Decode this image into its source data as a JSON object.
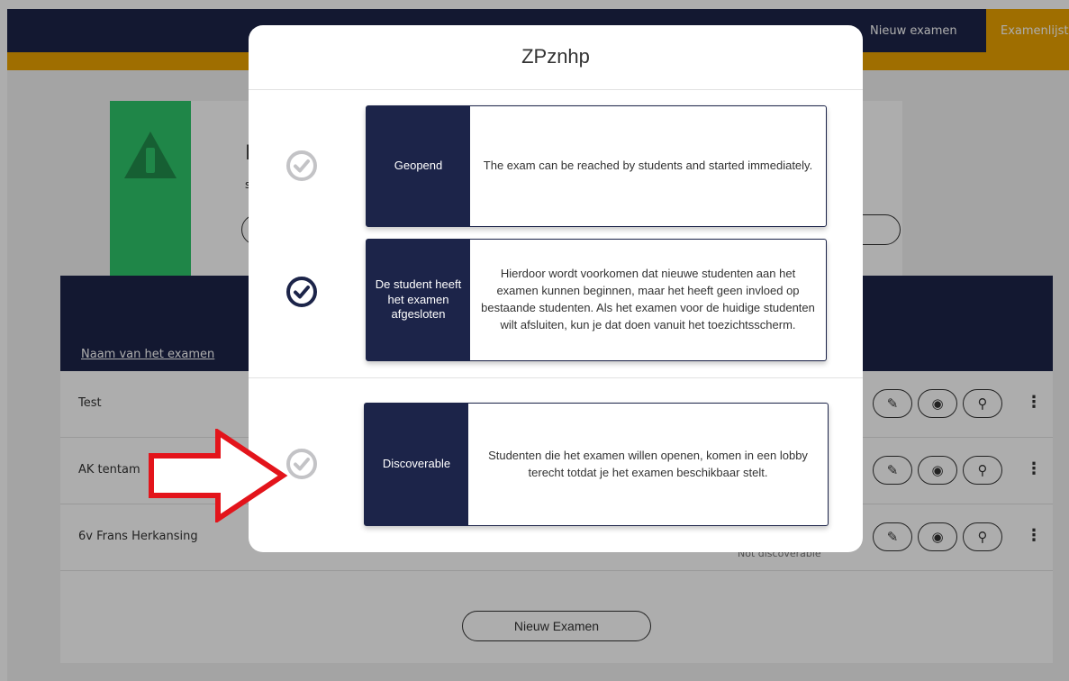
{
  "topbar": {
    "nav_new_exam": "Nieuw examen",
    "nav_exam_list": "Examenlijst",
    "colors": {
      "navy": "#1c2449",
      "orange": "#eaa200"
    }
  },
  "warning": {
    "icon": "warning-triangle-icon",
    "title_partial": "N",
    "sub_partial": "s"
  },
  "table": {
    "header_name": "Naam van het examen",
    "rows": [
      {
        "name": "Test",
        "status": ""
      },
      {
        "name": "AK tentam",
        "status": ""
      },
      {
        "name": "6v Frans Herkansing",
        "status": "Not discoverable"
      }
    ],
    "actions": [
      "edit-icon",
      "view-icon",
      "monitor-binoculars-icon"
    ],
    "new_exam_label": "Nieuw Examen"
  },
  "modal": {
    "title": "ZPznhp",
    "options": [
      {
        "label": "Geopend",
        "description": "The exam can be reached by students and started immediately.",
        "selected": false
      },
      {
        "label": "De student heeft het examen afgesloten",
        "description": "Hierdoor wordt voorkomen dat nieuwe studenten aan het examen kunnen beginnen, maar het heeft geen invloed op bestaande studenten. Als het examen voor de huidige studenten wilt afsluiten, kun je dat doen vanuit het toezichtsscherm.",
        "selected": true
      },
      {
        "label": "Discoverable",
        "description": "Studenten die het examen willen openen, komen in een lobby terecht totdat je het examen beschikbaar stelt.",
        "selected": false
      }
    ]
  },
  "annotation": {
    "arrow_color": "#e3141b"
  }
}
